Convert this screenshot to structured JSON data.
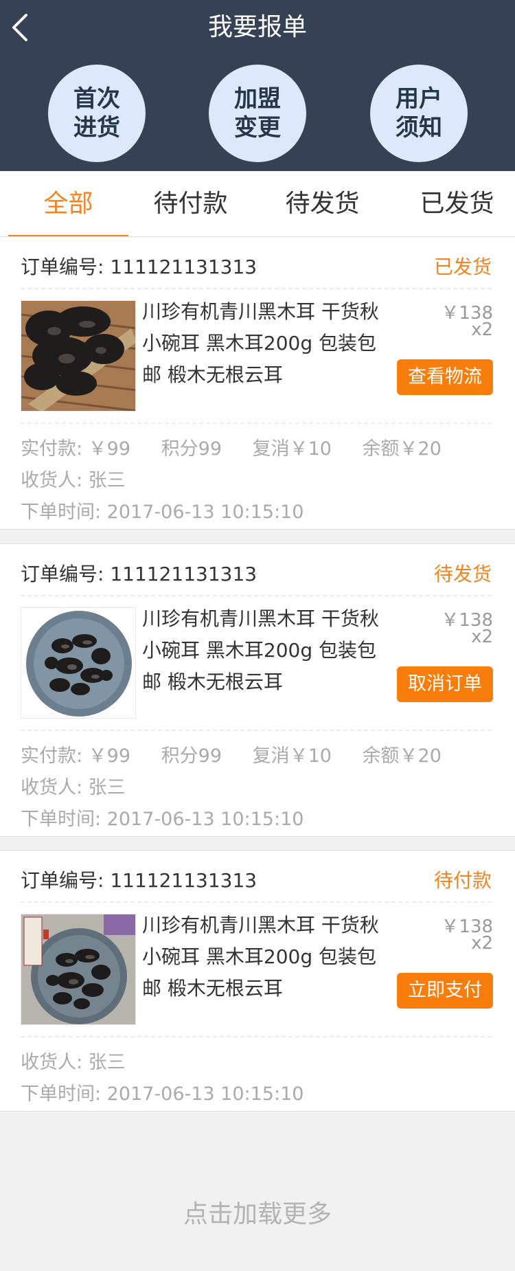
{
  "header": {
    "title": "我要报单",
    "back_icon": "chevron-left-icon"
  },
  "quick_links": [
    {
      "label": "首次进货"
    },
    {
      "label": "加盟变更"
    },
    {
      "label": "用户须知"
    }
  ],
  "tabs": [
    {
      "label": "全部",
      "active": true
    },
    {
      "label": "待付款",
      "active": false
    },
    {
      "label": "待发货",
      "active": false
    },
    {
      "label": "已发货",
      "active": false
    }
  ],
  "colors": {
    "header_bg": "#354256",
    "accent": "#f5841f",
    "button": "#f97d0b",
    "circle": "#dbe9fb"
  },
  "orders": [
    {
      "order_no_label": "订单编号: 111121131313",
      "status": "已发货",
      "product_name": "川珍有机青川黑木耳 干货秋小碗耳 黑木耳200g 包装包邮 椴木无根云耳",
      "price": "￥138",
      "qty": "x2",
      "action": "查看物流",
      "paid": "实付款: ￥99",
      "points": "积分99",
      "resale": "复消￥10",
      "balance": "余额￥20",
      "receiver": "收货人:  张三",
      "order_time": "下单时间:  2017-06-13 10:15:10"
    },
    {
      "order_no_label": "订单编号: 111121131313",
      "status": "待发货",
      "product_name": "川珍有机青川黑木耳 干货秋小碗耳 黑木耳200g 包装包邮 椴木无根云耳",
      "price": "￥138",
      "qty": "x2",
      "action": "取消订单",
      "paid": "实付款: ￥99",
      "points": "积分99",
      "resale": "复消￥10",
      "balance": "余额￥20",
      "receiver": "收货人:  张三",
      "order_time": "下单时间:  2017-06-13 10:15:10"
    },
    {
      "order_no_label": "订单编号: 111121131313",
      "status": "待付款",
      "product_name": "川珍有机青川黑木耳 干货秋小碗耳 黑木耳200g 包装包邮 椴木无根云耳",
      "price": "￥138",
      "qty": "x2",
      "action": "立即支付",
      "receiver": "收货人:  张三",
      "order_time": "下单时间:  2017-06-13 10:15:10"
    }
  ],
  "footer": {
    "load_more": "点击加载更多"
  }
}
